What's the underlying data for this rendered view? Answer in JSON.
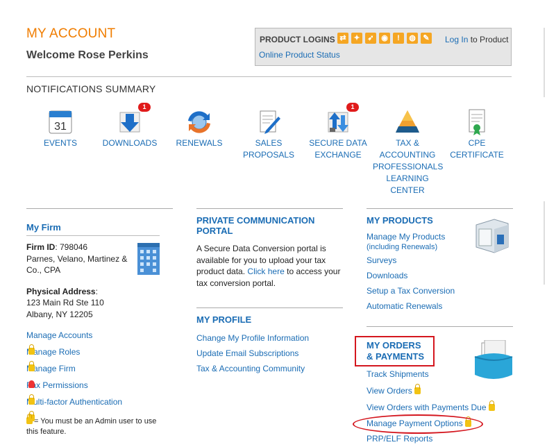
{
  "header": {
    "title": "MY ACCOUNT",
    "welcome": "Welcome Rose Perkins"
  },
  "product_logins": {
    "label": "PRODUCT LOGINS",
    "login_link": "Log In",
    "login_suffix": "to Product",
    "status_link": "Online Product Status"
  },
  "notifications": {
    "title": "NOTIFICATIONS SUMMARY",
    "tiles": [
      {
        "label": "EVENTS",
        "icon": "calendar-icon"
      },
      {
        "label": "DOWNLOADS",
        "icon": "download-icon",
        "badge": "1"
      },
      {
        "label": "RENEWALS",
        "icon": "renewals-icon"
      },
      {
        "label": "SALES PROPOSALS",
        "icon": "proposal-icon"
      },
      {
        "label": "SECURE DATA EXCHANGE",
        "icon": "data-exchange-icon",
        "badge": "1"
      },
      {
        "label": "TAX & ACCOUNTING PROFESSIONALS LEARNING CENTER",
        "icon": "pyramid-icon"
      },
      {
        "label": "CPE CERTIFICATE",
        "icon": "certificate-icon"
      }
    ]
  },
  "firm": {
    "title": "My Firm",
    "id_label": "Firm ID",
    "id_value": ": 798046",
    "name": "Parnes, Velano, Martinez & Co., CPA",
    "address_label": "Physical Address",
    "address_line1": "123 Main Rd Ste 110",
    "address_line2": "Albany, NY 12205",
    "links": [
      "Manage Accounts",
      "Manage Roles",
      "Manage Firm",
      "Fax Permissions",
      "Multi-factor Authentication"
    ],
    "note": "= You must be an Admin user to use this feature."
  },
  "portal": {
    "title": "PRIVATE COMMUNICATION PORTAL",
    "text_before": "A Secure Data Conversion portal is available for you to upload your tax product data.",
    "link": "Click here",
    "text_after": "to access your tax conversion portal."
  },
  "profile": {
    "title": "MY PROFILE",
    "links": [
      "Change My Profile Information",
      "Update Email Subscriptions",
      "Tax & Accounting Community"
    ]
  },
  "products": {
    "title": "MY PRODUCTS",
    "first_link": "Manage My Products",
    "first_sub": "(including Renewals)",
    "links": [
      "Surveys",
      "Downloads",
      "Setup a Tax Conversion",
      "Automatic Renewals"
    ]
  },
  "orders": {
    "title_line1": "MY ORDERS",
    "title_line2": "& PAYMENTS",
    "links": [
      "Track Shipments",
      "View Orders",
      "View Orders with Payments Due",
      "Manage Payment Options",
      "PRP/ELF Reports"
    ]
  },
  "colors": {
    "accent": "#f07d00",
    "link": "#1a6cb4",
    "highlight": "#d4161e"
  }
}
